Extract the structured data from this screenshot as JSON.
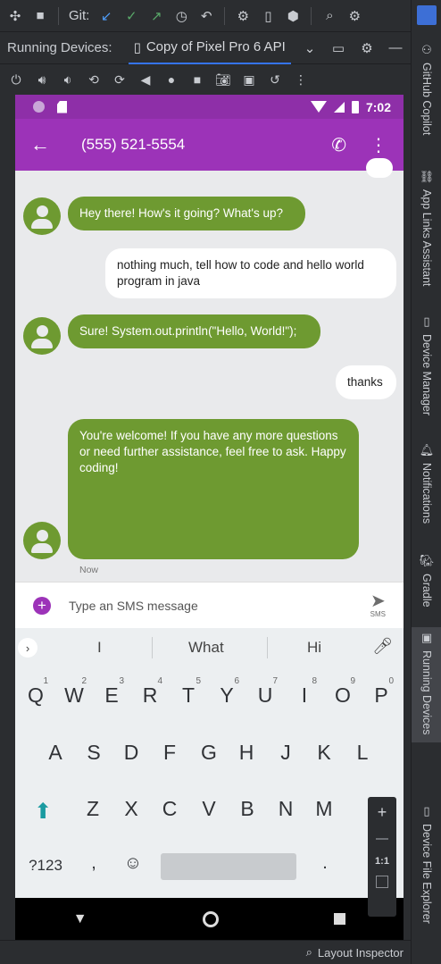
{
  "ide": {
    "git_label": "Git:",
    "running_devices_title": "Running Devices:",
    "device_tab_label": "Copy of Pixel Pro 6 API",
    "layout_inspector_label": "Layout Inspector",
    "side_tools": [
      {
        "label": "GitHub Copilot",
        "icon": "copilot-icon"
      },
      {
        "label": "App Links Assistant",
        "icon": "app-links-icon"
      },
      {
        "label": "Device Manager",
        "icon": "device-manager-icon"
      },
      {
        "label": "Notifications",
        "icon": "bell-icon"
      },
      {
        "label": "Gradle",
        "icon": "gradle-icon"
      },
      {
        "label": "Running Devices",
        "icon": "running-devices-icon"
      },
      {
        "label": "Device File Explorer",
        "icon": "file-explorer-icon"
      }
    ]
  },
  "phone": {
    "status_time": "7:02",
    "contact": "(555) 521-5554",
    "messages": [
      {
        "dir": "in",
        "text": "Hey there! How's it going? What's up?"
      },
      {
        "dir": "out",
        "text": "nothing much, tell how to code and hello world program in java"
      },
      {
        "dir": "in",
        "text": "Sure! System.out.println(\"Hello, World!\");"
      },
      {
        "dir": "out",
        "text": "thanks"
      },
      {
        "dir": "in",
        "text": "You're welcome! If you have any more questions or need further assistance, feel free to ask. Happy coding!"
      }
    ],
    "last_time": "Now",
    "compose_placeholder": "Type an SMS message",
    "send_label": "SMS",
    "suggestions": [
      "I",
      "What",
      "Hi"
    ],
    "row1": [
      "Q",
      "W",
      "E",
      "R",
      "T",
      "Y",
      "U",
      "I",
      "O",
      "P"
    ],
    "row1_nums": [
      "1",
      "2",
      "3",
      "4",
      "5",
      "6",
      "7",
      "8",
      "9",
      "0"
    ],
    "row2": [
      "A",
      "S",
      "D",
      "F",
      "G",
      "H",
      "J",
      "K",
      "L"
    ],
    "row3": [
      "Z",
      "X",
      "C",
      "V",
      "B",
      "N",
      "M"
    ],
    "sym_key": "?123",
    "comma_key": ",",
    "period_key": "."
  },
  "zoom": {
    "plus": "+",
    "ratio": "1:1"
  }
}
